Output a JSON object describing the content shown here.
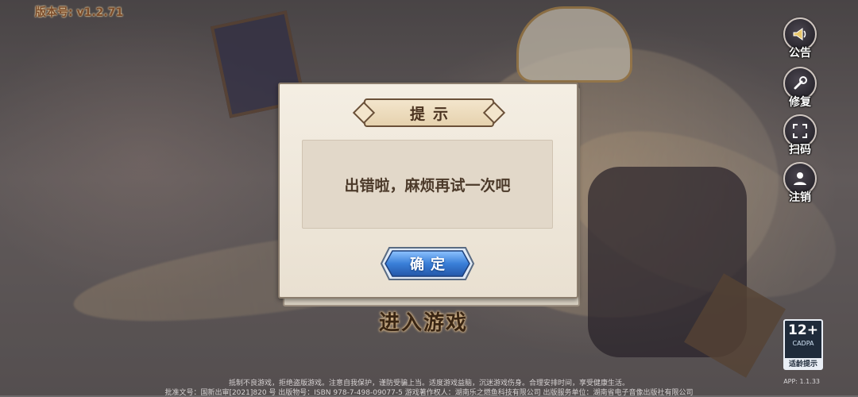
{
  "header": {
    "version": "版本号: v1.2.71"
  },
  "side_menu": [
    {
      "label": "公告",
      "icon": "megaphone-icon"
    },
    {
      "label": "修复",
      "icon": "wrench-icon"
    },
    {
      "label": "扫码",
      "icon": "qr-scan-icon"
    },
    {
      "label": "注销",
      "icon": "user-logout-icon"
    }
  ],
  "dialog": {
    "title": "提示",
    "message": "出错啦，麻烦再试一次吧",
    "ok_label": "确定"
  },
  "enter_game": "进入游戏",
  "age_rating": {
    "age": "12+",
    "org": "CADPA",
    "tip": "适龄提示"
  },
  "app_version": "APP: 1.1.33",
  "footer": {
    "line1": "抵制不良游戏，拒绝盗版游戏。注意自我保护，谨防受骗上当。适度游戏益脑，沉迷游戏伤身。合理安排时间，享受健康生活。",
    "line2": "批准文号：国新出审[2021]820 号 出版物号：ISBN 978-7-498-09077-5 游戏著作权人：湖南乐之燃鱼科技有限公司 出版服务单位：湖南省电子音像出版社有限公司"
  },
  "colors": {
    "button_blue": "#3a7fd8",
    "dialog_bg": "#f1ebe0",
    "title_brown": "#4b3320"
  }
}
